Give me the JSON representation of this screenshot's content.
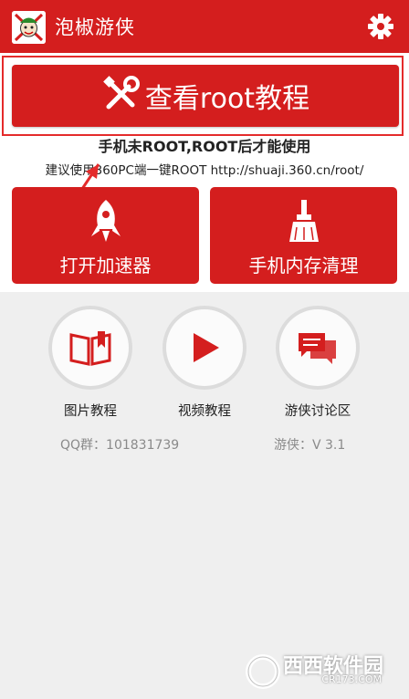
{
  "header": {
    "title": "泡椒游侠",
    "settings_icon": "gear-icon",
    "brand_color": "#d41e1e"
  },
  "root_button": {
    "label": "查看root教程",
    "icon": "tools-icon"
  },
  "notice": {
    "line1": "手机未ROOT,ROOT后才能使用",
    "line2": "建议使用360PC端一键ROOT http://shuaji.360.cn/root/"
  },
  "tiles": [
    {
      "label": "打开加速器",
      "icon": "rocket-icon"
    },
    {
      "label": "手机内存清理",
      "icon": "broom-icon"
    }
  ],
  "shortcuts": [
    {
      "label": "图片教程",
      "icon": "book-icon"
    },
    {
      "label": "视频教程",
      "icon": "play-icon"
    },
    {
      "label": "游侠讨论区",
      "icon": "chat-bubbles-icon"
    }
  ],
  "footer": {
    "qq": "QQ群：101831739",
    "version": "游侠：V 3.1"
  },
  "watermark": {
    "text": "西西软件园",
    "sub": "CR173.COM"
  }
}
